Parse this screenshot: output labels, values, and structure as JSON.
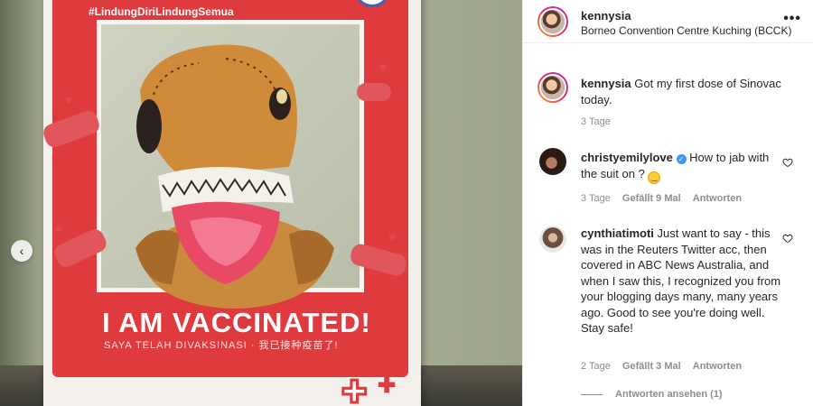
{
  "photo": {
    "hashtag": "#LindungDiriLindungSemua",
    "headline": "I AM VACCINATED!",
    "subline": "SAYA TELAH DIVAKSINASI · 我已接种疫苗了!",
    "prev_button": "‹"
  },
  "post": {
    "author": "kennysia",
    "location": "Borneo Convention Centre Kuching (BCCK)",
    "more_icon": "•••"
  },
  "caption": {
    "user": "kennysia",
    "text": "Got my first dose of Sinovac today.",
    "time": "3 Tage"
  },
  "comments": [
    {
      "user": "christyemilylove",
      "verified": true,
      "text": "How to jab with the suit on ?",
      "emoji": "grinning-sweat-emoji",
      "time": "3 Tage",
      "likes": "Gefällt 9 Mal",
      "reply": "Antworten"
    },
    {
      "user": "cynthiatimoti",
      "verified": false,
      "text": "Just want to say - this was in the Reuters Twitter acc, then covered in ABC News Australia, and when I saw this, I recognized you from your blogging days many, many years ago. Good to see you're doing well. Stay safe!",
      "time": "2 Tage",
      "likes": "Gefällt 3 Mal",
      "reply": "Antworten",
      "view_replies": "Antworten ansehen (1)"
    }
  ],
  "colors": {
    "poster_red": "#df3b3f",
    "link_blue": "#3897f0",
    "muted": "#8e8e8e"
  }
}
